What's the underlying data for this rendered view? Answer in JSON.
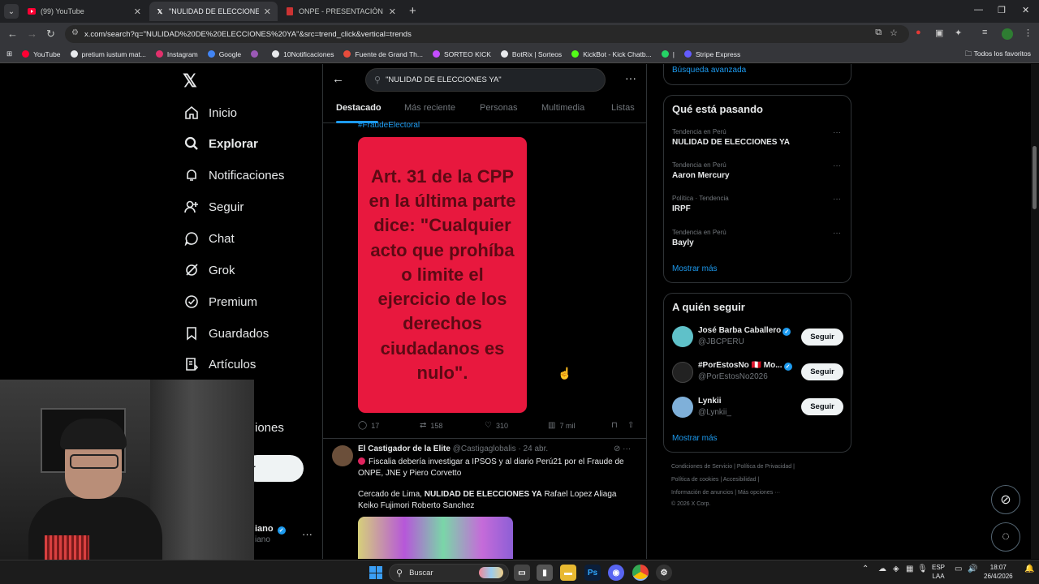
{
  "browser": {
    "tabs": [
      {
        "title": "(99) YouTube",
        "favicon_color": "#ff0033",
        "active": false
      },
      {
        "title": "\"NULIDAD DE ELECCIONES YA\"",
        "favicon_color": "#ffffff",
        "active": true
      },
      {
        "title": "ONPE - PRESENTACIÓN DE RE:",
        "favicon_color": "#cc3333",
        "active": false
      }
    ],
    "url": "x.com/search?q=\"NULIDAD%20DE%20ELECCIONES%20YA\"&src=trend_click&vertical=trends",
    "bookmarks": [
      {
        "label": "YouTube",
        "color": "#ff0033"
      },
      {
        "label": "pretium iustum mat...",
        "color": "#e8eaed"
      },
      {
        "label": "Instagram",
        "color": "#e1306c"
      },
      {
        "label": "Google",
        "color": "#4285f4"
      },
      {
        "label": "",
        "color": "#9b59b6"
      },
      {
        "label": "10Notificaciones",
        "color": "#e8eaed"
      },
      {
        "label": "Fuente de Grand Th...",
        "color": "#e74c3c"
      },
      {
        "label": "SORTEO KICK",
        "color": "#c44dff"
      },
      {
        "label": "BotRix | Sorteos",
        "color": "#e8eaed"
      },
      {
        "label": "KickBot - Kick Chatb...",
        "color": "#53fc18"
      },
      {
        "label": "|",
        "color": "#25d366"
      },
      {
        "label": "Stripe Express",
        "color": "#635bff"
      }
    ],
    "all_bookmarks": "Todos los favoritos"
  },
  "sidebar": {
    "items": [
      {
        "label": "Inicio",
        "icon": "home-icon"
      },
      {
        "label": "Explorar",
        "icon": "search-icon",
        "bold": true
      },
      {
        "label": "Notificaciones",
        "icon": "bell-icon"
      },
      {
        "label": "Seguir",
        "icon": "add-person-icon"
      },
      {
        "label": "Chat",
        "icon": "chat-icon"
      },
      {
        "label": "Grok",
        "icon": "grok-icon"
      },
      {
        "label": "Premium",
        "icon": "premium-icon"
      },
      {
        "label": "Guardados",
        "icon": "bookmark-icon"
      },
      {
        "label": "Artículos",
        "icon": "articles-icon"
      }
    ],
    "partial_item": "iones",
    "post_label": "r",
    "profile_name": "iano",
    "profile_handle": "iano"
  },
  "search": {
    "query": "\"NULIDAD DE ELECCIONES YA\"",
    "tabs": [
      "Destacado",
      "Más reciente",
      "Personas",
      "Multimedia",
      "Listas"
    ]
  },
  "tweet1": {
    "hashtag": "#FraudeElectoral",
    "image_text": "Art. 31 de la CPP en la última parte dice: \"Cualquier acto que prohíba o limite el ejercicio de los derechos ciudadanos es nulo\".",
    "replies": "17",
    "retweets": "158",
    "likes": "310",
    "views": "7 mil"
  },
  "tweet2": {
    "name": "El Castigador de la Elite",
    "handle": "@Castigaglobalis",
    "date": "· 24 abr.",
    "text1": "Fiscalia debería investigar a IPSOS y al diario Perú21 por el Fraude de ONPE, JNE y Piero Corvetto",
    "text2_prefix": "Cercado de Lima, ",
    "text2_bold": "NULIDAD DE ELECCIONES YA",
    "text2_suffix": " Rafael Lopez Aliaga Keiko Fujimori Roberto Sanchez"
  },
  "right": {
    "advanced_search": "Búsqueda avanzada",
    "trends_title": "Qué está pasando",
    "trends": [
      {
        "category": "Tendencia en Perú",
        "name": "NULIDAD DE ELECCIONES YA"
      },
      {
        "category": "Tendencia en Perú",
        "name": "Aaron Mercury"
      },
      {
        "category": "Política · Tendencia",
        "name": "IRPF"
      },
      {
        "category": "Tendencia en Perú",
        "name": "Bayly"
      }
    ],
    "show_more": "Mostrar más",
    "who_to_follow_title": "A quién seguir",
    "follow": [
      {
        "name": "José Barba Caballero",
        "handle": "@JBCPERU",
        "avatar_color": "#5fc1c9"
      },
      {
        "name": "#PorEstosNo 🇵🇪 Mo...",
        "handle": "@PorEstosNo2026",
        "avatar_color": "#222222"
      },
      {
        "name": "Lynkii",
        "handle": "@Lynkii_",
        "avatar_color": "#7fb0d9"
      }
    ],
    "follow_button": "Seguir",
    "footer_line1": [
      "Condiciones de Servicio",
      "|",
      "Política de Privacidad",
      "|"
    ],
    "footer_line2": [
      "Política de cookies",
      "|",
      "Accesibilidad",
      "|"
    ],
    "footer_line3": [
      "Información de anuncios",
      "|",
      "Más opciones ···"
    ],
    "copyright": "© 2026 X Corp."
  },
  "taskbar": {
    "search_label": "Buscar",
    "lang_line1": "ESP",
    "lang_line2": "LAA",
    "time": "18:07",
    "date": "26/4/2026"
  }
}
